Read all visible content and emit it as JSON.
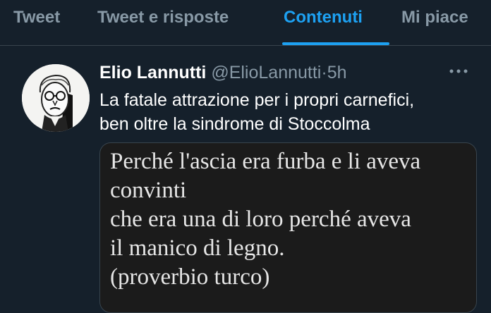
{
  "tabs": [
    {
      "label": "Tweet",
      "active": false
    },
    {
      "label": "Tweet e risposte",
      "active": false
    },
    {
      "label": "Contenuti",
      "active": true
    },
    {
      "label": "Mi piace",
      "active": false
    }
  ],
  "colors": {
    "background": "#15202b",
    "accent": "#1da1f2",
    "secondary_text": "#8899a6",
    "divider": "#38444d"
  },
  "tweet": {
    "author_name": "Elio Lannutti",
    "handle": "@ElioLannutti",
    "separator": "·",
    "time": "5h",
    "more_icon": "more-horizontal-icon",
    "text_lines": [
      "La fatale attrazione per i propri carnefici,",
      "ben oltre la sindrome di Stoccolma"
    ],
    "image_text_lines": [
      "Perché l'ascia era furba e li aveva",
      "convinti",
      "che era una di loro perché aveva",
      "il manico di legno.",
      "(proverbio turco)"
    ]
  }
}
